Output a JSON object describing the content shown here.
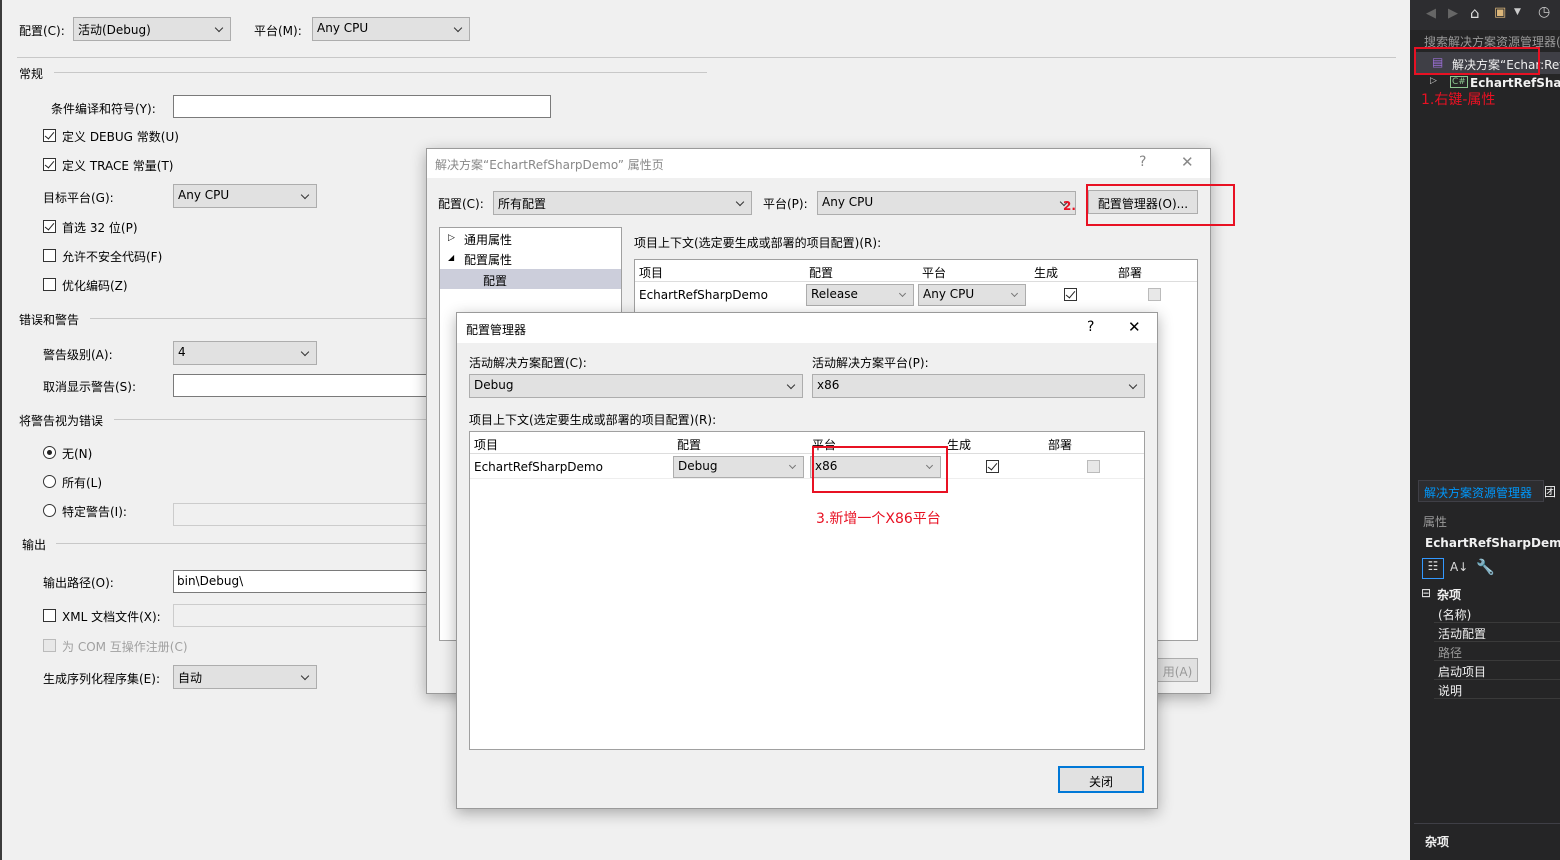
{
  "project_page": {
    "config_label": "配置(C):",
    "config_value": "活动(Debug)",
    "platform_label": "平台(M):",
    "platform_value": "Any CPU",
    "sections": {
      "general": "常规",
      "errors": "错误和警告",
      "treat_warnings": "将警告视为错误",
      "output": "输出"
    },
    "cond_symbols_label": "条件编译和符号(Y):",
    "cond_symbols_value": "",
    "define_debug": "定义 DEBUG 常数(U)",
    "define_trace": "定义 TRACE 常量(T)",
    "target_platform_label": "目标平台(G):",
    "target_platform_value": "Any CPU",
    "prefer32": "首选 32 位(P)",
    "unsafe": "允许不安全代码(F)",
    "optimize": "优化编码(Z)",
    "warning_level_label": "警告级别(A):",
    "warning_level_value": "4",
    "suppress_label": "取消显示警告(S):",
    "radio_none": "无(N)",
    "radio_all": "所有(L)",
    "radio_specific": "特定警告(I):",
    "output_path_label": "输出路径(O):",
    "output_path_value": "bin\\Debug\\",
    "xml_doc": "XML 文档文件(X):",
    "com_register": "为 COM 互操作注册(C)",
    "serialization_label": "生成序列化程序集(E):",
    "serialization_value": "自动"
  },
  "props_dialog": {
    "title": "解决方案“EchartRefSharpDemo” 属性页",
    "help": "?",
    "close": "✕",
    "config_label": "配置(C):",
    "config_value": "所有配置",
    "platform_label": "平台(P):",
    "platform_value": "Any CPU",
    "config_manager_button": "配置管理器(O)...",
    "annotation": "2.",
    "tree": [
      "通用属性",
      "配置属性",
      "配置"
    ],
    "context_label": "项目上下文(选定要生成或部署的项目配置)(R):",
    "columns": [
      "项目",
      "配置",
      "平台",
      "生成",
      "部署"
    ],
    "row": {
      "project": "EchartRefSharpDemo",
      "config": "Release",
      "platform": "Any CPU",
      "build": true,
      "deploy": false
    },
    "apply_button": "用(A)"
  },
  "config_manager": {
    "title": "配置管理器",
    "help": "?",
    "close": "✕",
    "active_config_label": "活动解决方案配置(C):",
    "active_config_value": "Debug",
    "active_platform_label": "活动解决方案平台(P):",
    "active_platform_value": "x86",
    "context_label": "项目上下文(选定要生成或部署的项目配置)(R):",
    "columns": [
      "项目",
      "配置",
      "平台",
      "生成",
      "部署"
    ],
    "row": {
      "project": "EchartRefSharpDemo",
      "config": "Debug",
      "platform": "x86",
      "build": true,
      "deploy": false
    },
    "annotation": "3.新增一个X86平台",
    "close_button": "关闭"
  },
  "solution_explorer": {
    "search_placeholder": "搜索解决方案资源管理器(",
    "solution_item": "解决方案“Echar:Ref",
    "project_item": "EchartRefSharp",
    "annotation": "1.右键-属性",
    "tabs": [
      "解决方案资源管理器",
      "团"
    ]
  },
  "properties_panel": {
    "title": "属性",
    "object": "EchartRefSharpDemo",
    "category": "杂项",
    "rows": [
      "(名称)",
      "活动配置",
      "路径",
      "启动项目",
      "说明"
    ],
    "footer": "杂项"
  },
  "colors": {
    "accent": "#0078d7",
    "annotation": "#e81123",
    "dark_panel": "#252526"
  }
}
